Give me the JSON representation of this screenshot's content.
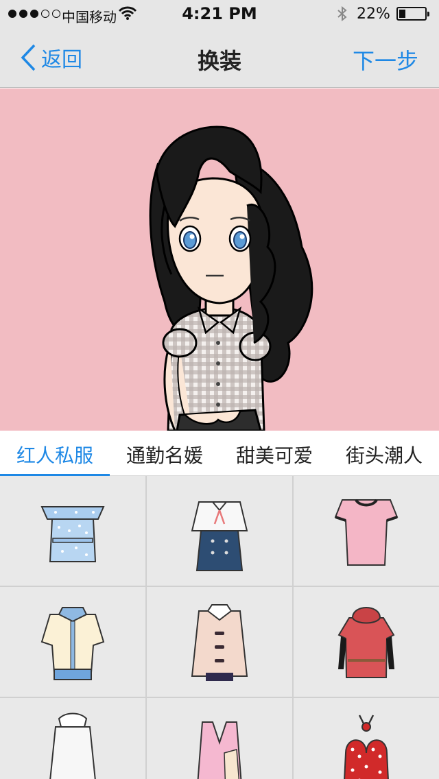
{
  "status_bar": {
    "carrier": "中国移动",
    "time": "4:21 PM",
    "battery": "22%",
    "signal_bars_filled": 3,
    "signal_bars_total": 5
  },
  "nav": {
    "back_label": "返回",
    "title": "换装",
    "next_label": "下一步",
    "accent_color": "#1e88e5"
  },
  "stage": {
    "background_color": "#f2bcc2"
  },
  "tabs": [
    {
      "label": "红人私服",
      "active": true
    },
    {
      "label": "通勤名媛",
      "active": false
    },
    {
      "label": "甜美可爱",
      "active": false
    },
    {
      "label": "街头潮人",
      "active": false
    }
  ],
  "outfits": [
    {
      "icon": "blue-polka-ruffle-dress-icon"
    },
    {
      "icon": "white-blouse-navy-skirt-icon"
    },
    {
      "icon": "pink-tshirt-dress-icon"
    },
    {
      "icon": "cream-collar-blouse-icon"
    },
    {
      "icon": "beige-toggle-cardigan-icon"
    },
    {
      "icon": "red-hooded-dress-icon"
    },
    {
      "icon": "white-ruffle-neck-top-icon"
    },
    {
      "icon": "pink-sleeveless-dress-icon"
    },
    {
      "icon": "red-polka-halter-top-icon"
    }
  ]
}
